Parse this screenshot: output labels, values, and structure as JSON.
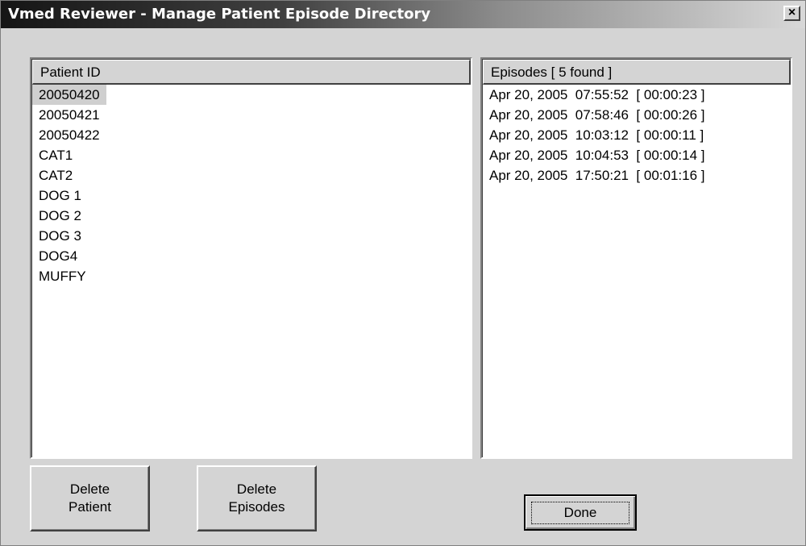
{
  "window": {
    "title": "Vmed Reviewer - Manage Patient Episode Directory",
    "close_label": "×"
  },
  "patients": {
    "header": "Patient ID",
    "items": [
      "20050420",
      "20050421",
      "20050422",
      "CAT1",
      "CAT2",
      "DOG 1",
      "DOG 2",
      "DOG 3",
      "DOG4",
      "MUFFY"
    ],
    "selected_index": 0
  },
  "episodes": {
    "header": "Episodes [ 5 found ]",
    "items": [
      "Apr 20, 2005  07:55:52  [ 00:00:23 ]",
      "Apr 20, 2005  07:58:46  [ 00:00:26 ]",
      "Apr 20, 2005  10:03:12  [ 00:00:11 ]",
      "Apr 20, 2005  10:04:53  [ 00:00:14 ]",
      "Apr 20, 2005  17:50:21  [ 00:01:16 ]"
    ]
  },
  "buttons": {
    "delete_patient_line1": "Delete",
    "delete_patient_line2": "Patient",
    "delete_episodes_line1": "Delete",
    "delete_episodes_line2": "Episodes",
    "done": "Done"
  }
}
